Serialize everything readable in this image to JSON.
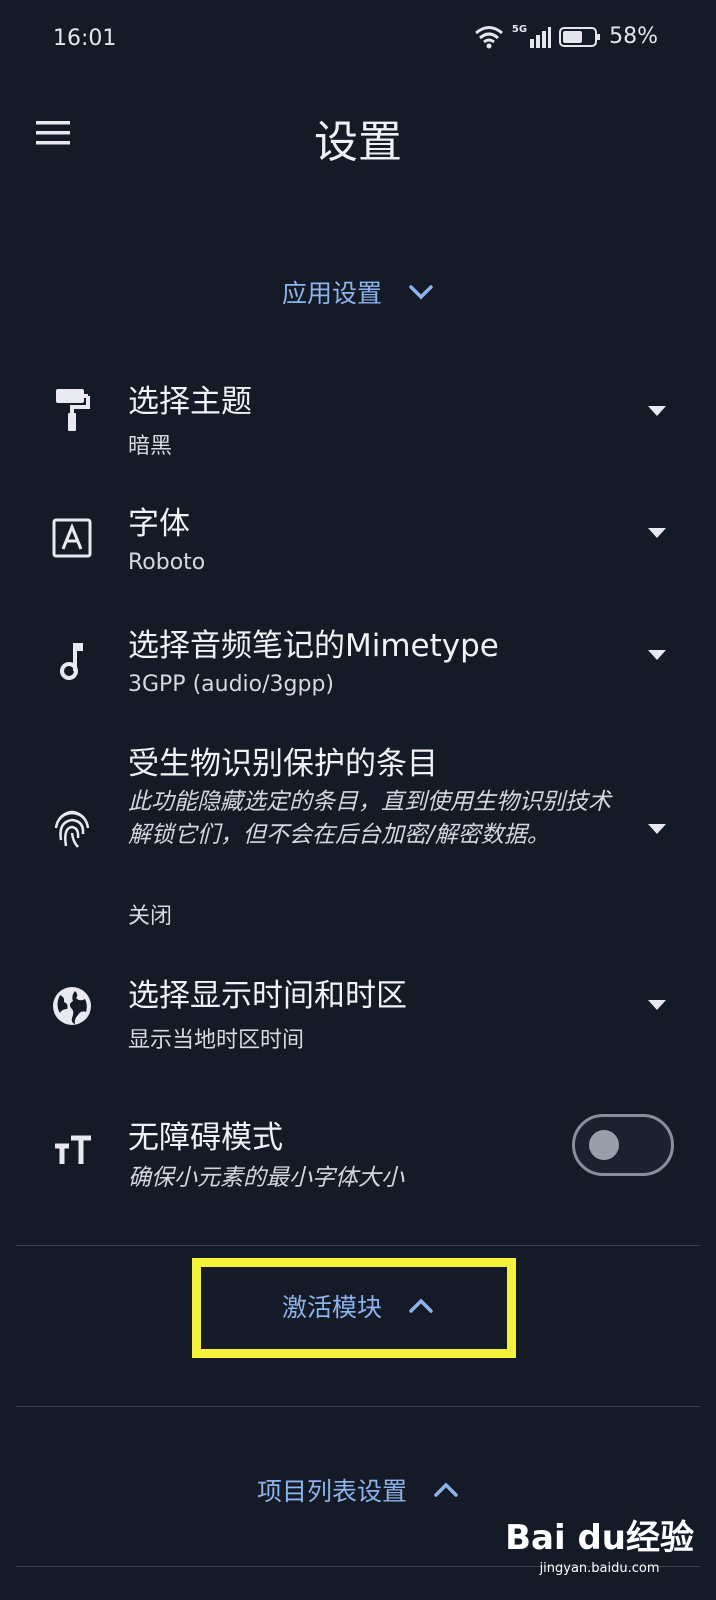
{
  "status_bar": {
    "time": "16:01",
    "network": "5G",
    "battery_pct": "58%"
  },
  "header": {
    "title": "设置",
    "menu_icon": "hamburger-icon"
  },
  "app_settings": {
    "header": "应用设置",
    "items": [
      {
        "icon": "paint-roller-icon",
        "title": "选择主题",
        "value": "暗黑"
      },
      {
        "icon": "font-icon",
        "title": "字体",
        "value": "Roboto"
      },
      {
        "icon": "music-note-icon",
        "title": "选择音频笔记的Mimetype",
        "value": "3GPP (audio/3gpp)"
      },
      {
        "icon": "fingerprint-icon",
        "title": "受生物识别保护的条目",
        "description": "此功能隐藏选定的条目，直到使用生物识别技术解锁它们，但不会在后台加密/解密数据。",
        "value": "关闭"
      },
      {
        "icon": "globe-icon",
        "title": "选择显示时间和时区",
        "value": "显示当地时区时间"
      },
      {
        "icon": "text-size-icon",
        "title": "无障碍模式",
        "description": "确保小元素的最小字体大小",
        "toggle_on": false
      }
    ]
  },
  "activate_modules": {
    "header": "激活模块"
  },
  "item_list_settings": {
    "header": "项目列表设置"
  },
  "watermark": {
    "logo": "Bai du经验",
    "url": "jingyan.baidu.com"
  },
  "colors": {
    "background": "#151a27",
    "accent": "#8cb4ec",
    "highlight": "#f4f13b"
  }
}
